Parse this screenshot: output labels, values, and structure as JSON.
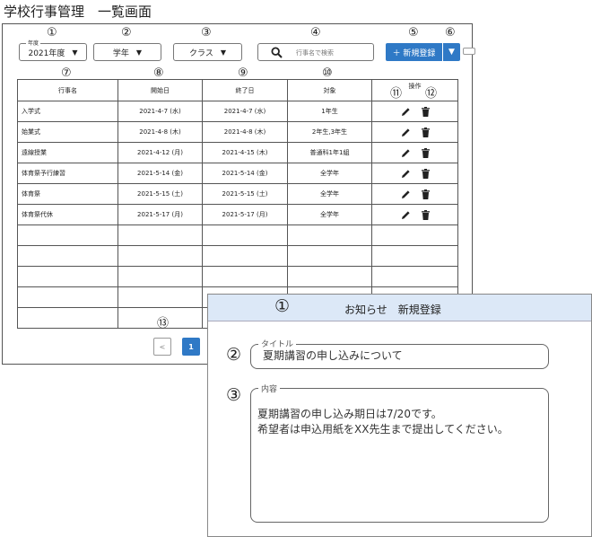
{
  "page": {
    "title": "学校行事管理　一覧画面"
  },
  "markers": [
    "①",
    "②",
    "③",
    "④",
    "⑤",
    "⑥",
    "⑦",
    "⑧",
    "⑨",
    "⑩",
    "⑪",
    "⑫",
    "⑬"
  ],
  "filters": {
    "year": {
      "legend": "年度",
      "value": "2021年度"
    },
    "grade": {
      "value": "学年"
    },
    "class": {
      "value": "クラス"
    },
    "caret": "▼"
  },
  "search": {
    "placeholder": "行事名で検索",
    "icon": "search-icon"
  },
  "toolbar": {
    "new_label": "＋ 新規登録",
    "dropdown_label": "▼"
  },
  "table": {
    "headers": [
      "行事名",
      "開始日",
      "終了日",
      "対象",
      "操作"
    ],
    "rows": [
      [
        "入学式",
        "2021-4-7 (水)",
        "2021-4-7 (水)",
        "1年生"
      ],
      [
        "始業式",
        "2021-4-8 (木)",
        "2021-4-8 (木)",
        "2年生,3年生"
      ],
      [
        "遠線授業",
        "2021-4-12 (月)",
        "2021-4-15 (木)",
        "普通科1年1組"
      ],
      [
        "体育祭予行練習",
        "2021-5-14 (金)",
        "2021-5-14 (金)",
        "全学年"
      ],
      [
        "体育祭",
        "2021-5-15 (土)",
        "2021-5-15 (土)",
        "全学年"
      ],
      [
        "体育祭代休",
        "2021-5-17 (月)",
        "2021-5-17 (月)",
        "全学年"
      ]
    ],
    "empty_rows": 5,
    "icons": [
      "edit-icon",
      "trash-icon"
    ]
  },
  "pager": {
    "prev": "<",
    "current": "1"
  },
  "modal": {
    "title": "お知らせ　新規登録",
    "title_field": {
      "legend": "タイトル",
      "value": "夏期講習の申し込みについて"
    },
    "content_field": {
      "legend": "内容",
      "value": "夏期講習の申し込み期日は7/20です。\n希望者は申込用紙をXX先生まで提出してください。"
    }
  },
  "colors": {
    "accent": "#2f79c6",
    "modal_header": "#dce8f7"
  }
}
